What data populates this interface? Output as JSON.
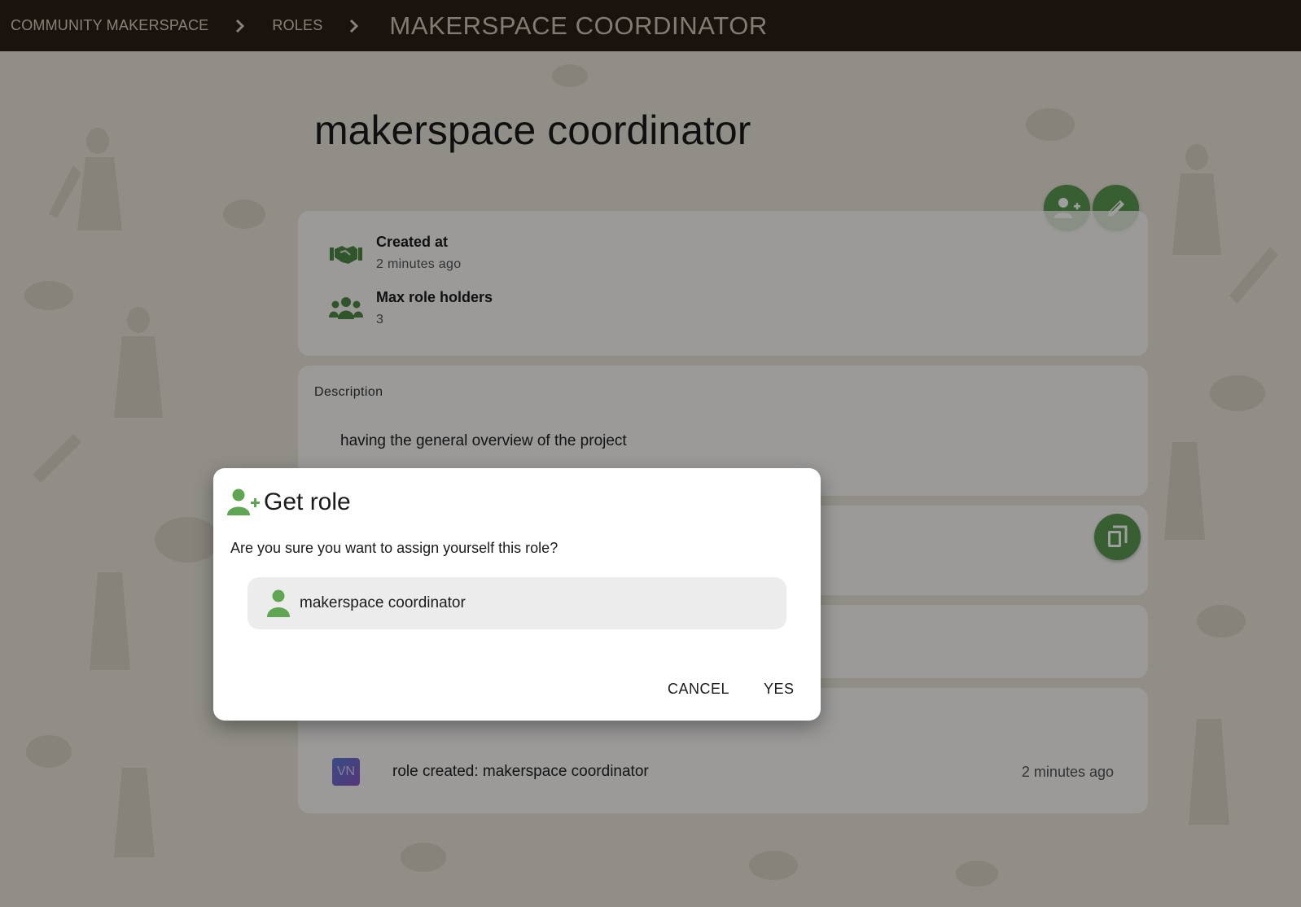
{
  "breadcrumb": {
    "items": [
      "COMMUNITY MAKERSPACE",
      "ROLES"
    ],
    "current": "MAKERSPACE COORDINATOR"
  },
  "role": {
    "title": "makerspace coordinator",
    "info": [
      {
        "label": "Created at",
        "value": "2 minutes ago",
        "icon": "handshake-icon"
      },
      {
        "label": "Max role holders",
        "value": "3",
        "icon": "users-group-icon"
      }
    ],
    "description_label": "Description",
    "description": "having the general overview of the project"
  },
  "history": {
    "avatar_initials": "VN",
    "entry": "role created: makerspace coordinator",
    "time": "2 minutes ago"
  },
  "dialog": {
    "title": "Get role",
    "question": "Are you sure you want to assign yourself this role?",
    "role_name": "makerspace coordinator",
    "cancel_label": "CANCEL",
    "confirm_label": "YES"
  },
  "colors": {
    "topbar": "#2b1f15",
    "accent_green": "#5b9a4f",
    "icon_green": "#4e8a46",
    "dialog_bg": "#ffffff"
  }
}
